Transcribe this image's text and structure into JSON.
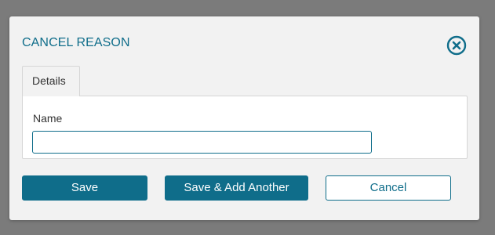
{
  "dialog": {
    "title": "CANCEL REASON",
    "close_icon": "close-circle-icon"
  },
  "tabs": [
    {
      "label": "Details",
      "active": true
    }
  ],
  "form": {
    "name_label": "Name",
    "name_value": "",
    "name_placeholder": ""
  },
  "buttons": {
    "save_label": "Save",
    "save_add_label": "Save & Add Another",
    "cancel_label": "Cancel"
  },
  "colors": {
    "accent": "#0f6d8a",
    "overlay": "#7b7b7b",
    "dialog_bg": "#f2f2f2"
  }
}
